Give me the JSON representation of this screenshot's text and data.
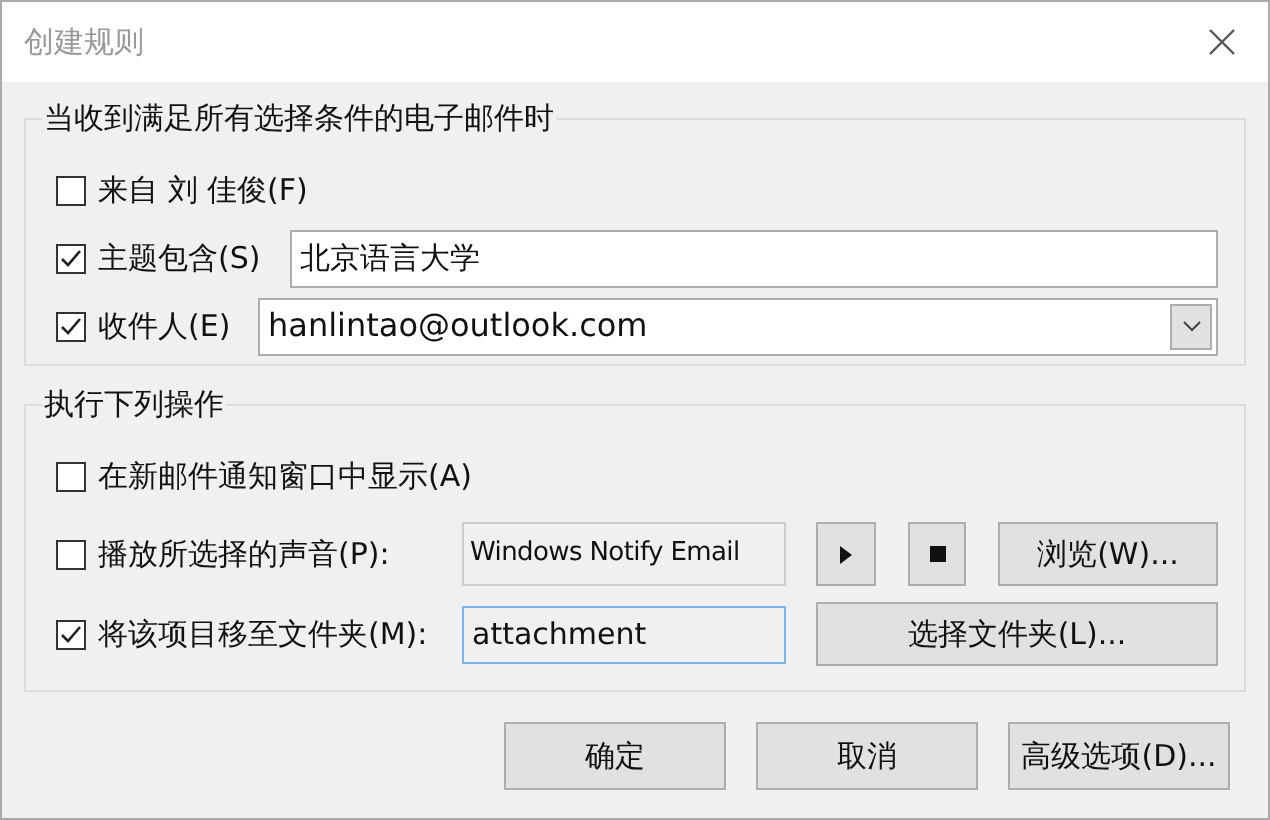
{
  "window": {
    "title": "创建规则"
  },
  "conditions": {
    "title": "当收到满足所有选择条件的电子邮件时",
    "rows": [
      {
        "kind": "plain",
        "label": "来自 刘 佳俊(F)",
        "checked": false
      },
      {
        "kind": "text",
        "label": "主题包含(S)",
        "checked": true,
        "value": "北京语言大学"
      },
      {
        "kind": "combo",
        "label": "收件人(E)",
        "checked": true,
        "value": "hanlintao@outlook.com"
      }
    ]
  },
  "actions": {
    "title": "执行下列操作",
    "rows": [
      {
        "kind": "plain",
        "label": "在新邮件通知窗口中显示(A)",
        "checked": false
      },
      {
        "kind": "sound",
        "label": "播放所选择的声音(P):",
        "checked": false,
        "value": "Windows Notify Email",
        "button": "浏览(W)..."
      },
      {
        "kind": "folder",
        "label": "将该项目移至文件夹(M):",
        "checked": true,
        "value": "attachment",
        "button": "选择文件夹(L)..."
      }
    ]
  },
  "buttons": [
    "确定",
    "取消",
    "高级选项(D)..."
  ]
}
